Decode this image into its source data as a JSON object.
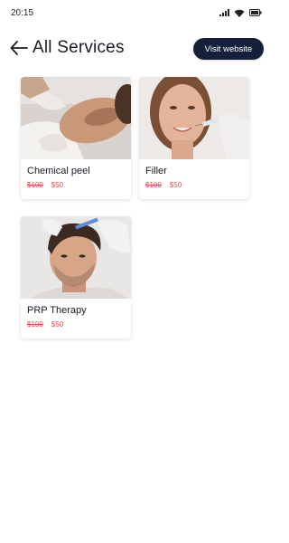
{
  "status_bar": {
    "time": "20:15",
    "icons": [
      "signal-icon",
      "wifi-icon",
      "battery-icon"
    ]
  },
  "header": {
    "title": "All Services",
    "back_icon": "arrow-left-icon",
    "visit_button_label": "Visit website"
  },
  "colors": {
    "primary_button": "#15203a",
    "price_red": "#e84a4a",
    "text": "#1b1b24"
  },
  "services": [
    {
      "name": "Chemical peel",
      "old_price": "$100",
      "new_price": "$50",
      "image": "chemical-peel-photo"
    },
    {
      "name": "Filler",
      "old_price": "$100",
      "new_price": "$50",
      "image": "filler-photo"
    },
    {
      "name": "PRP Therapy",
      "old_price": "$100",
      "new_price": "$50",
      "image": "prp-therapy-photo"
    }
  ]
}
